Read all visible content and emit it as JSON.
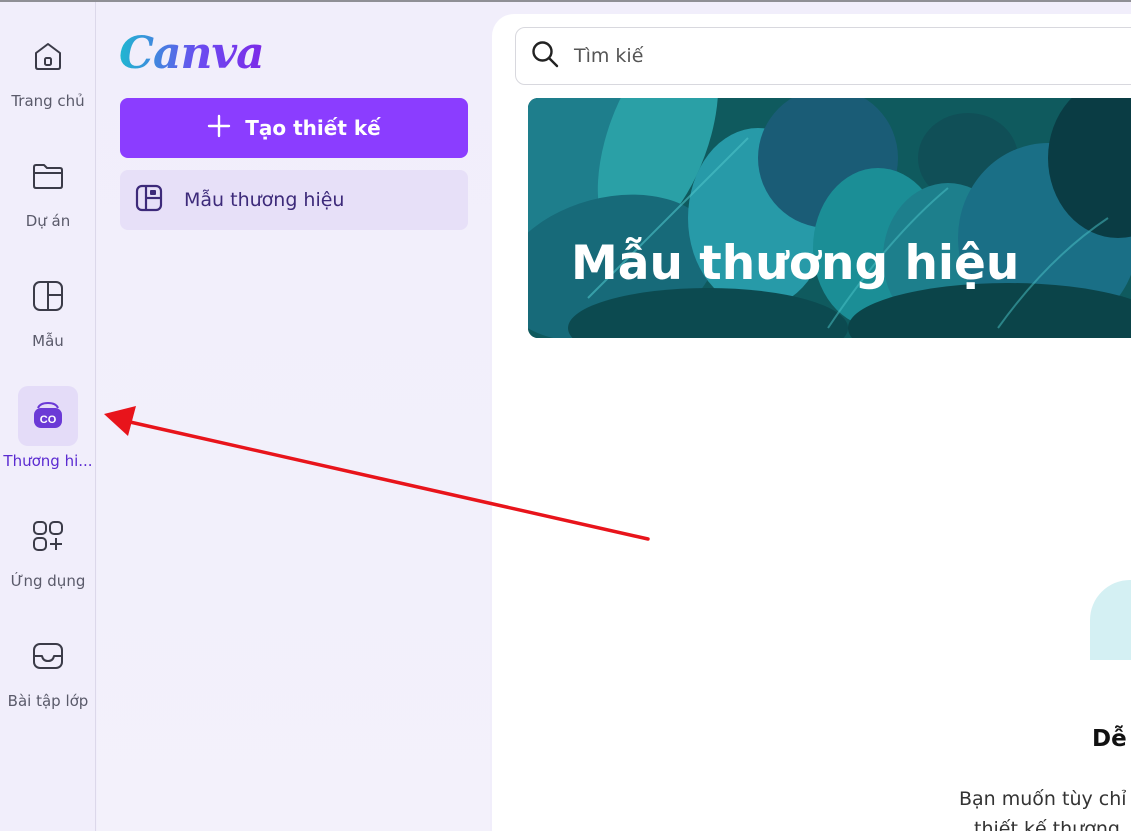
{
  "rail": {
    "items": [
      {
        "label": "Trang chủ",
        "icon": "home-icon"
      },
      {
        "label": "Dự án",
        "icon": "folder-icon"
      },
      {
        "label": "Mẫu",
        "icon": "template-icon"
      },
      {
        "label": "Thương hi...",
        "icon": "brand-kit-icon",
        "active": true
      },
      {
        "label": "Ứng dụng",
        "icon": "apps-icon"
      },
      {
        "label": "Bài tập lớp",
        "icon": "inbox-icon"
      }
    ]
  },
  "panel": {
    "logo": "Canva",
    "create_button": "Tạo thiết kế",
    "brand_templates": "Mẫu thương hiệu"
  },
  "main": {
    "search_placeholder": "Tìm kiế",
    "hero_title": "Mẫu thương hiệu",
    "heading_fragment": "Dễ",
    "body_line1": "Bạn muốn tùy chỉ",
    "body_line2": "thiết kế thương"
  },
  "colors": {
    "accent": "#8b3dff",
    "rail_active_bg": "#e4dcf8",
    "arrow": "#e8141b"
  }
}
